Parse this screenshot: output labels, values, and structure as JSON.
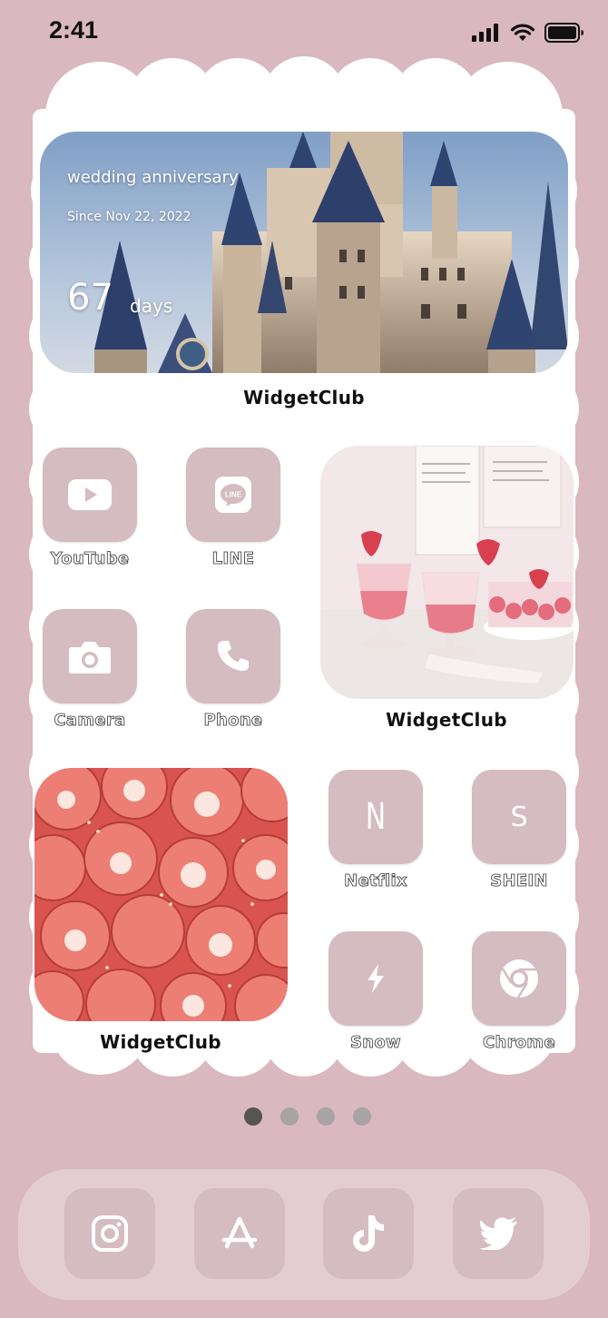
{
  "status_bar": {
    "time": "2:41"
  },
  "anniversary_widget": {
    "title": "wedding anniversary",
    "since": "Since Nov 22, 2022",
    "count": "67",
    "unit": "days",
    "caption": "WidgetClub"
  },
  "dessert_widget": {
    "caption": "WidgetClub"
  },
  "strawberry_widget": {
    "caption": "WidgetClub"
  },
  "apps": [
    {
      "label": "YouTube",
      "icon": "youtube-icon"
    },
    {
      "label": "LINE",
      "icon": "line-icon"
    },
    {
      "label": "Camera",
      "icon": "camera-icon"
    },
    {
      "label": "Phone",
      "icon": "phone-icon"
    },
    {
      "label": "Netflix",
      "icon": "netflix-icon",
      "glyph": "N"
    },
    {
      "label": "SHEIN",
      "icon": "shein-icon",
      "glyph": "S"
    },
    {
      "label": "Snow",
      "icon": "snow-icon"
    },
    {
      "label": "Chrome",
      "icon": "chrome-icon"
    }
  ],
  "page_indicator": {
    "pages": 4,
    "active": 1
  },
  "dock": [
    {
      "icon": "instagram-icon"
    },
    {
      "icon": "app-store-icon"
    },
    {
      "icon": "tiktok-icon"
    },
    {
      "icon": "twitter-icon"
    }
  ],
  "colors": {
    "background": "#d9b8c0",
    "tile": "#d4bcc1",
    "cloud": "#ffffff",
    "dock": "#e3cdd2"
  }
}
